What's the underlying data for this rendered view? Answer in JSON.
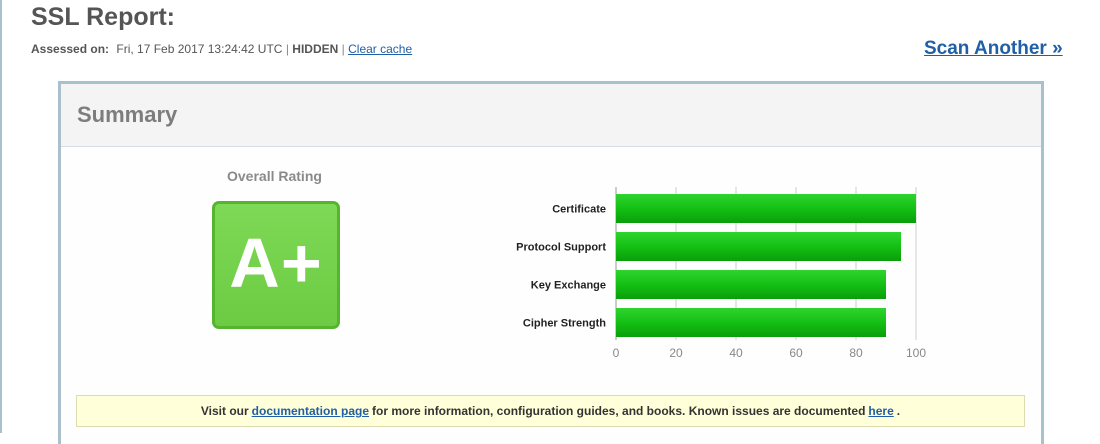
{
  "header": {
    "title": "SSL Report:",
    "assessed_label": "Assessed on:",
    "assessed_date": "Fri, 17 Feb 2017 13:24:42 UTC",
    "sep1": "|",
    "hidden": "HIDDEN",
    "sep2": "|",
    "clear_cache": "Clear cache",
    "scan_another": "Scan Another »"
  },
  "summary": {
    "title": "Summary",
    "overall_label": "Overall Rating",
    "grade": "A+",
    "grade_color": "#6ccb42"
  },
  "notice": {
    "pre": "Visit our",
    "link1": "documentation page",
    "mid": "for more information, configuration guides, and books. Known issues are documented",
    "link2": "here",
    "post": "."
  },
  "chart_data": {
    "type": "bar",
    "orientation": "horizontal",
    "categories": [
      "Certificate",
      "Protocol Support",
      "Key Exchange",
      "Cipher Strength"
    ],
    "values": [
      100,
      95,
      90,
      90
    ],
    "xlim": [
      0,
      100
    ],
    "xticks": [
      0,
      20,
      40,
      60,
      80,
      100
    ],
    "grid": true,
    "bar_color": "#11b811"
  }
}
